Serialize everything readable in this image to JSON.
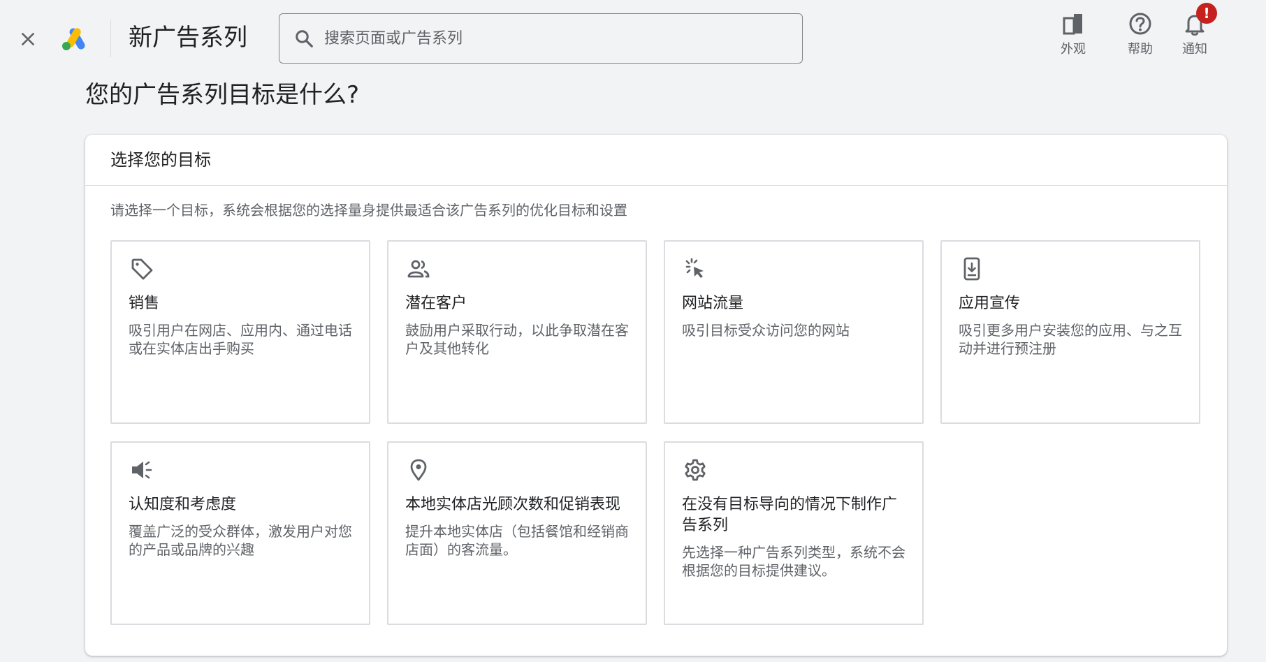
{
  "header": {
    "title": "新广告系列",
    "search_placeholder": "搜索页面或广告系列",
    "actions": [
      {
        "label": "外观",
        "icon": "appearance-icon"
      },
      {
        "label": "帮助",
        "icon": "help-icon"
      },
      {
        "label": "通知",
        "icon": "bell-icon",
        "badge": "!"
      }
    ]
  },
  "main": {
    "heading": "您的广告系列目标是什么?",
    "card": {
      "title": "选择您的目标",
      "description": "请选择一个目标，系统会根据您的选择量身提供最适合该广告系列的优化目标和设置",
      "goals": [
        {
          "title": "销售",
          "description": "吸引用户在网店、应用内、通过电话或在实体店出手购买",
          "icon": "tag-icon"
        },
        {
          "title": "潜在客户",
          "description": "鼓励用户采取行动，以此争取潜在客户及其他转化",
          "icon": "people-icon"
        },
        {
          "title": "网站流量",
          "description": "吸引目标受众访问您的网站",
          "icon": "click-cursor-icon"
        },
        {
          "title": "应用宣传",
          "description": "吸引更多用户安装您的应用、与之互动并进行预注册",
          "icon": "phone-download-icon"
        },
        {
          "title": "认知度和考虑度",
          "description": "覆盖广泛的受众群体，激发用户对您的产品或品牌的兴趣",
          "icon": "megaphone-icon"
        },
        {
          "title": "本地实体店光顾次数和促销表现",
          "description": "提升本地实体店（包括餐馆和经销商店面）的客流量。",
          "icon": "location-pin-icon"
        },
        {
          "title": "在没有目标导向的情况下制作广告系列",
          "description": "先选择一种广告系列类型，系统不会根据您的目标提供建议。",
          "icon": "gear-icon"
        }
      ]
    }
  },
  "colors": {
    "background": "#f1f3f4",
    "card": "#ffffff",
    "border": "#dadce0",
    "text_primary": "#202124",
    "text_secondary": "#5f6368",
    "badge": "#c5221f",
    "google_blue": "#4285f4",
    "google_yellow": "#fbbc04",
    "google_green": "#34a853"
  }
}
